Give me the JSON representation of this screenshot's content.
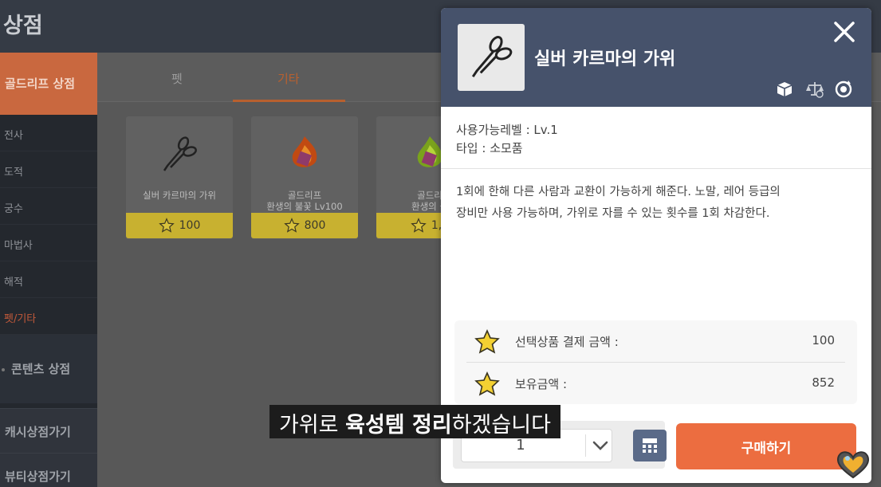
{
  "header": {
    "title": "상점"
  },
  "sidebar": {
    "main": "골드리프 상점",
    "items": [
      {
        "label": "전사",
        "active": false
      },
      {
        "label": "도적",
        "active": false
      },
      {
        "label": "궁수",
        "active": false
      },
      {
        "label": "마법사",
        "active": false
      },
      {
        "label": "해적",
        "active": false
      },
      {
        "label": "펫/기타",
        "active": true
      }
    ],
    "section": "콘텐츠 상점",
    "links": [
      "캐시상점가기",
      "뷰티상점가기"
    ]
  },
  "tabs": [
    {
      "label": "펫",
      "active": false
    },
    {
      "label": "기타",
      "active": true
    }
  ],
  "cards": [
    {
      "name_line1": "실버 카르마의 가위",
      "name_line2": "",
      "price": "100",
      "icon": "scissors-icon"
    },
    {
      "name_line1": "골드리프",
      "name_line2": "환생의 불꽃 Lv100",
      "price": "800",
      "icon": "red-flame-icon"
    },
    {
      "name_line1": "골드리",
      "name_line2": "환생의 불",
      "price": "1,0",
      "icon": "green-flame-icon"
    }
  ],
  "modal": {
    "title": "실버 카르마의 가위",
    "level": "사용가능레벨 : Lv.1",
    "type": "타입 : 소모품",
    "description_line1": "1회에 한해 다른 사람과 교환이 가능하게 해준다. 노말, 레어 등급의",
    "description_line2": "장비만 사용 가능하며, 가위로 자를 수 있는 횟수를 1회 차감한다.",
    "price_label": "선택상품 결제 금액 :",
    "price_value": "100",
    "balance_label": "보유금액 :",
    "balance_value": "852",
    "quantity": "1",
    "buy_label": "구매하기",
    "header_icons": [
      "box-icon",
      "trade-icon",
      "rotate-icon"
    ]
  },
  "subtitle": {
    "part1": "가위로 ",
    "bold": "육성템 정리",
    "part2": "하겠습니다"
  },
  "colors": {
    "accent": "#ec6d40",
    "header": "#46526b",
    "gold": "#c8b130"
  }
}
